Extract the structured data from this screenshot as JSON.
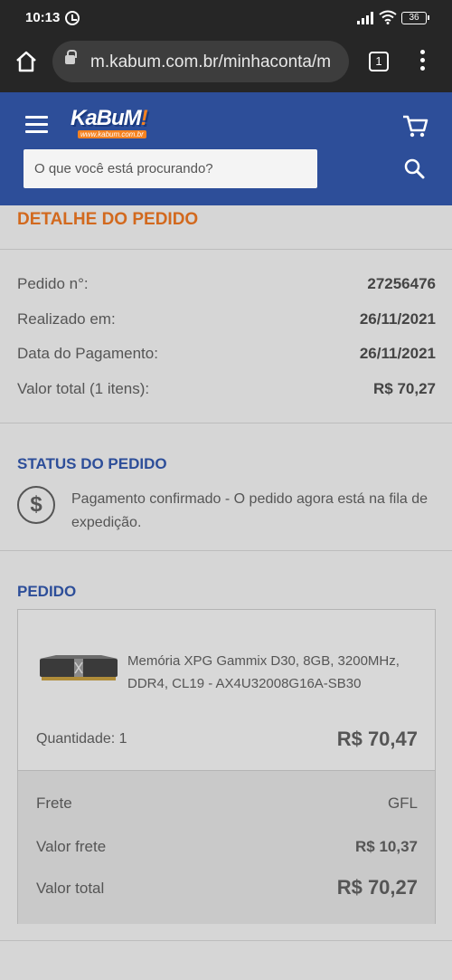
{
  "status_bar": {
    "time": "10:13",
    "battery": "36"
  },
  "browser": {
    "url": "m.kabum.com.br/minhaconta/m",
    "tab_count": "1"
  },
  "header": {
    "logo_text": "KaBuM",
    "logo_bang": "!",
    "logo_sub": "www.kabum.com.br",
    "search_placeholder": "O que você está procurando?"
  },
  "order": {
    "title": "DETALHE DO PEDIDO",
    "details": [
      {
        "label": "Pedido n°:",
        "value": "27256476"
      },
      {
        "label": "Realizado em:",
        "value": "26/11/2021"
      },
      {
        "label": "Data do Pagamento:",
        "value": "26/11/2021"
      },
      {
        "label": "Valor total (1 itens):",
        "value": "R$ 70,27"
      }
    ]
  },
  "status": {
    "title": "STATUS DO PEDIDO",
    "icon_glyph": "$",
    "text": "Pagamento confirmado - O pedido agora está na fila de expedição."
  },
  "pedido": {
    "title": "PEDIDO",
    "product_name": "Memória XPG Gammix D30, 8GB, 3200MHz, DDR4, CL19 - AX4U32008G16A-SB30",
    "quantity": "Quantidade: 1",
    "price": "R$ 70,47",
    "summary": {
      "frete_label": "Frete",
      "frete_value": "GFL",
      "valor_frete_label": "Valor frete",
      "valor_frete_value": "R$ 10,37",
      "valor_total_label": "Valor total",
      "valor_total_value": "R$ 70,27"
    }
  },
  "colors": {
    "header_blue": "#2d4e99",
    "title_orange": "#d2691e",
    "background": "#d6d6d6"
  }
}
